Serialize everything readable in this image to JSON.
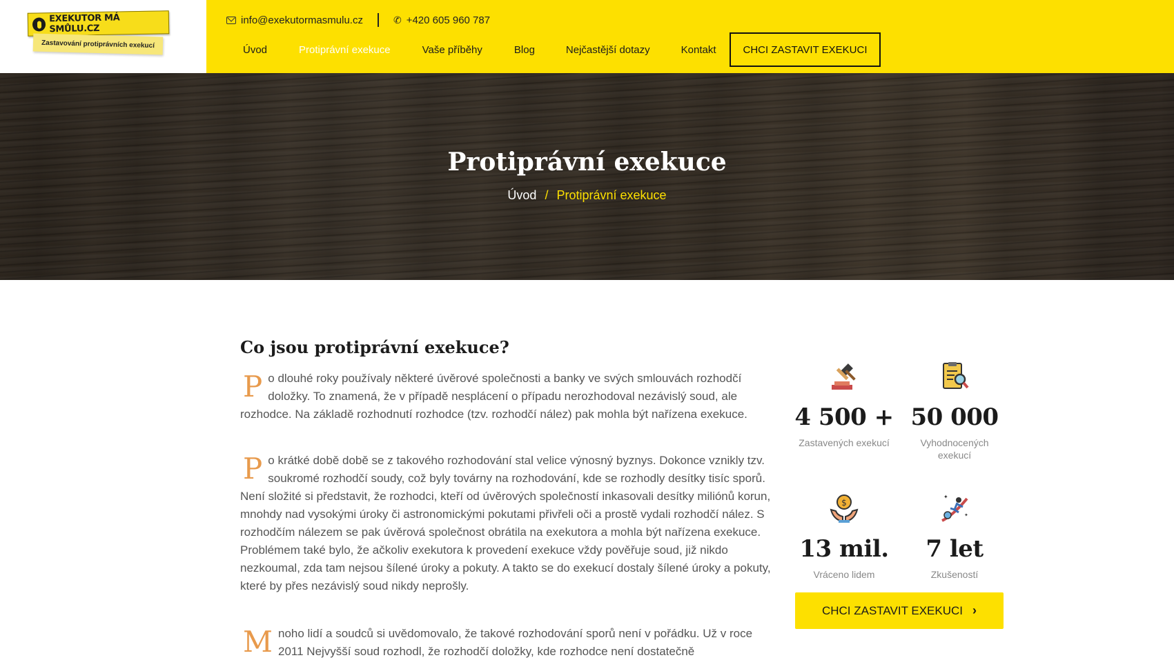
{
  "header": {
    "logo_title": "EXEKUTOR MÁ SMŮLU.CZ",
    "logo_subtitle": "Zastavování protiprávních exekucí",
    "email": "info@exekutormasmulu.cz",
    "phone": "+420 605 960 787",
    "nav": [
      {
        "label": "Úvod"
      },
      {
        "label": "Protiprávní exekuce",
        "active": true
      },
      {
        "label": "Vaše příběhy"
      },
      {
        "label": "Blog"
      },
      {
        "label": "Nejčastější dotazy"
      },
      {
        "label": "Kontakt"
      }
    ],
    "cta_label": "CHCI ZASTAVIT EXEKUCI"
  },
  "hero": {
    "title": "Protiprávní exekuce",
    "breadcrumb_home": "Úvod",
    "breadcrumb_sep": "/",
    "breadcrumb_current": "Protiprávní exekuce"
  },
  "article": {
    "heading": "Co jsou protiprávní exekuce?",
    "paragraphs": [
      {
        "initial": "P",
        "text": "o dlouhé roky používaly některé úvěrové společnosti a banky ve svých smlouvách rozhodčí doložky. To znamená, že v případě nesplácení o případu nerozhodoval nezávislý soud, ale rozhodce. Na základě rozhodnutí rozhodce (tzv. rozhodčí nález) pak mohla být nařízena exekuce."
      },
      {
        "initial": "P",
        "text": "o krátké době době se z takového rozhodování stal velice výnosný byznys. Dokonce vznikly tzv. soukromé rozhodčí soudy, což byly továrny na rozhodování, kde se rozhodly desítky tisíc sporů. Není složité si představit, že rozhodci, kteří od úvěrových společností inkasovali desítky miliónů korun, mnohdy nad vysokými úroky či astronomickými pokutami přivřeli oči a prostě vydali rozhodčí nález. S rozhodčím nálezem se pak úvěrová společnost obrátila na exekutora a mohla být nařízena exekuce. Problémem také bylo, že ačkoliv exekutora k provedení exekuce vždy pověřuje soud, již nikdo nezkoumal, zda tam nejsou šílené úroky a pokuty. A takto se do exekucí dostaly šílené úroky a pokuty, které by přes nezávislý soud nikdy neprošly."
      },
      {
        "initial": "M",
        "text": "noho lidí a soudců si uvědomovalo, že takové rozhodování sporů není v pořádku. Už v roce 2011 Nejvyšší soud rozhodl, že rozhodčí doložky, kde rozhodce není dostatečně"
      }
    ]
  },
  "stats": [
    {
      "icon": "gavel-icon",
      "number": "4 500 +",
      "label": "Zastavených exekucí"
    },
    {
      "icon": "document-search-icon",
      "number": "50 000",
      "label": "Vyhodnocených exekucí"
    },
    {
      "icon": "money-hands-icon",
      "number": "13 mil.",
      "label": "Vráceno lidem"
    },
    {
      "icon": "climber-icon",
      "number": "7 let",
      "label": "Zkušeností"
    }
  ],
  "sidebar_cta": {
    "label": "CHCI ZASTAVIT EXEKUCI",
    "chevron": "›"
  },
  "colors": {
    "brand_yellow": "#fde000",
    "drop_cap": "#e89a4c",
    "text": "#555555",
    "heading": "#1b1b1b"
  }
}
